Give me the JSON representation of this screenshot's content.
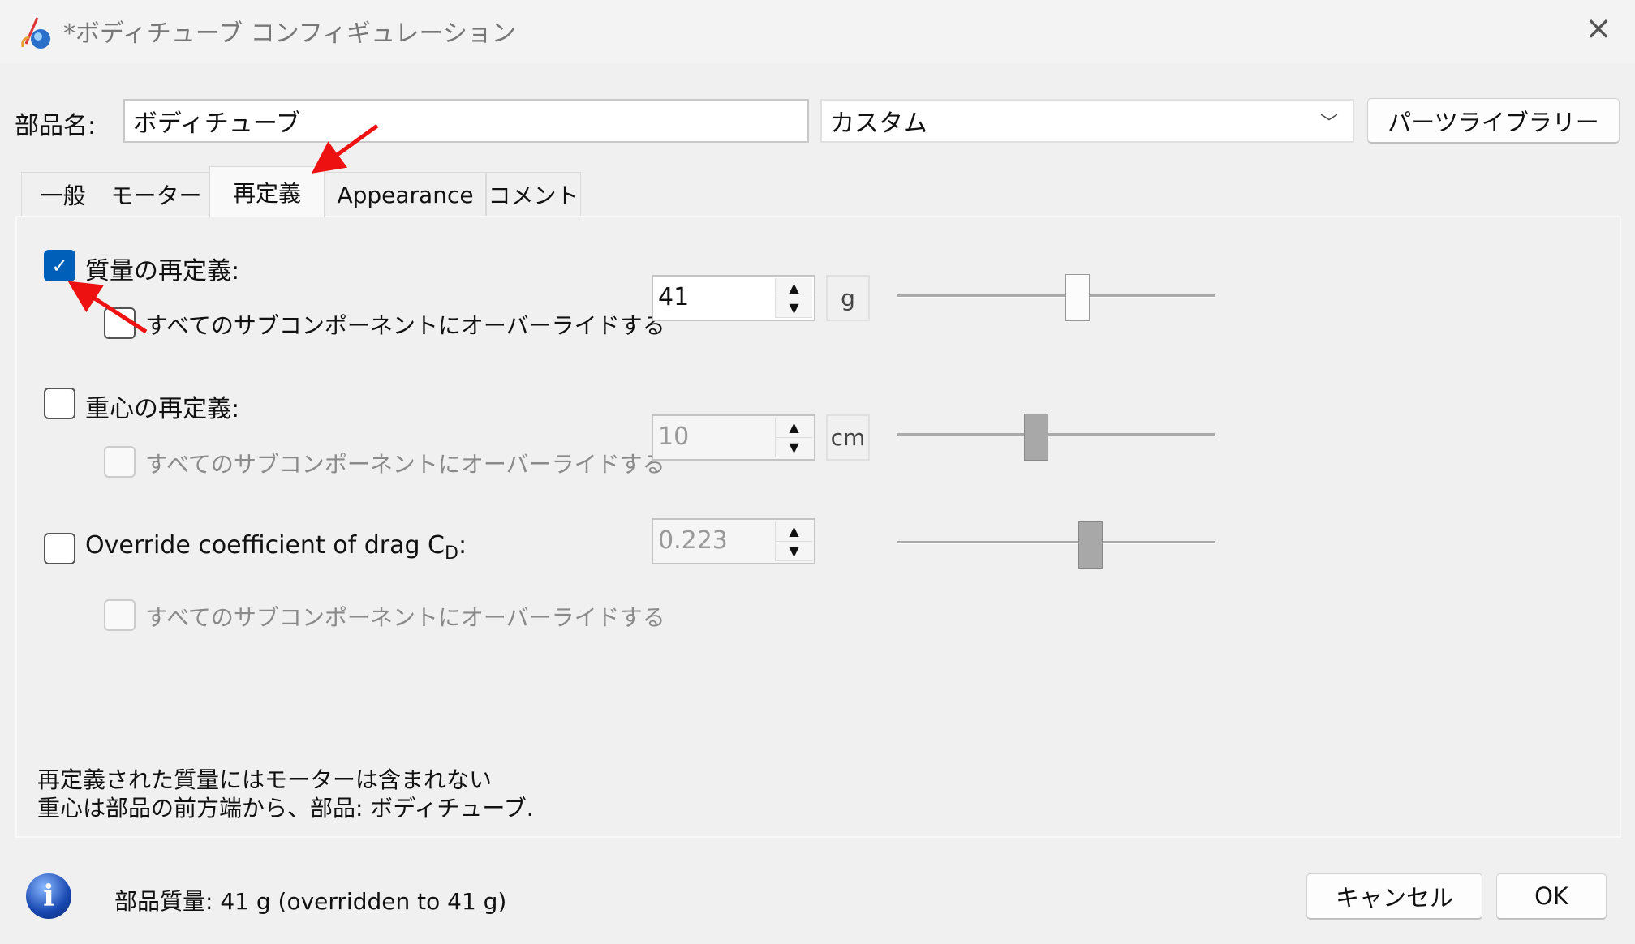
{
  "window": {
    "title": "*ボディチューブ コンフィギュレーション",
    "close_icon": "×"
  },
  "header": {
    "part_name_label": "部品名:",
    "part_name_value": "ボディチューブ",
    "preset_value": "カスタム",
    "parts_library_label": "パーツライブラリー"
  },
  "tabs": [
    {
      "label": "一般"
    },
    {
      "label": "モーター"
    },
    {
      "label": "再定義",
      "selected": true
    },
    {
      "label": "Appearance"
    },
    {
      "label": "コメント"
    }
  ],
  "overrides": {
    "mass": {
      "label": "質量の再定義:",
      "checked": true,
      "sub_label": "すべてのサブコンポーネントにオーバーライドする",
      "value": "41",
      "unit": "g",
      "slider_fraction": 0.57
    },
    "cg": {
      "label": "重心の再定義:",
      "checked": false,
      "sub_label": "すべてのサブコンポーネントにオーバーライドする",
      "value": "10",
      "unit": "cm",
      "slider_fraction": 0.44
    },
    "cd": {
      "label": "Override coefficient of drag C",
      "label_sub": "D",
      "label_suffix": ":",
      "checked": false,
      "sub_label": "すべてのサブコンポーネントにオーバーライドする",
      "value": "0.223",
      "slider_fraction": 0.61
    }
  },
  "notes": [
    "再定義された質量にはモーターは含まれない",
    "重心は部品の前方端から、部品: ボディチューブ."
  ],
  "footer": {
    "status": "部品質量: 41 g (overridden to 41 g)",
    "cancel_label": "キャンセル",
    "ok_label": "OK"
  },
  "colors": {
    "accent": "#005fb8",
    "annotation_arrow": "#ee1111"
  }
}
